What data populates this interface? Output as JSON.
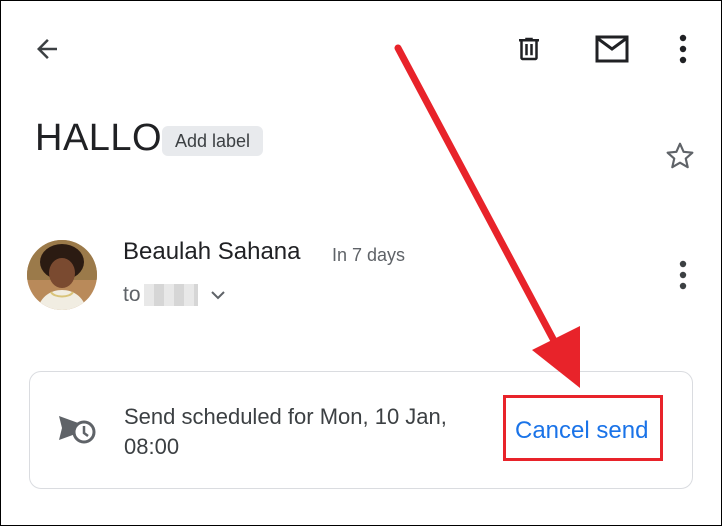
{
  "toolbar": {
    "back_icon": "arrow-left-icon",
    "delete_icon": "trash-icon",
    "mark_unread_icon": "envelope-icon",
    "more_icon": "more-vertical-icon"
  },
  "email": {
    "subject": "HALLO",
    "add_label": "Add label",
    "star_icon": "star-outline-icon"
  },
  "message": {
    "sender": "Beaulah Sahana",
    "time": "In 7 days",
    "to_prefix": "to",
    "expand_icon": "chevron-down-icon",
    "more_icon": "more-vertical-icon"
  },
  "schedule": {
    "icon": "scheduled-send-icon",
    "text": "Send scheduled for Mon, 10 Jan, 08:00",
    "cancel_label": "Cancel send"
  },
  "colors": {
    "accent": "#1a73e8",
    "annotation": "#e8232a"
  }
}
